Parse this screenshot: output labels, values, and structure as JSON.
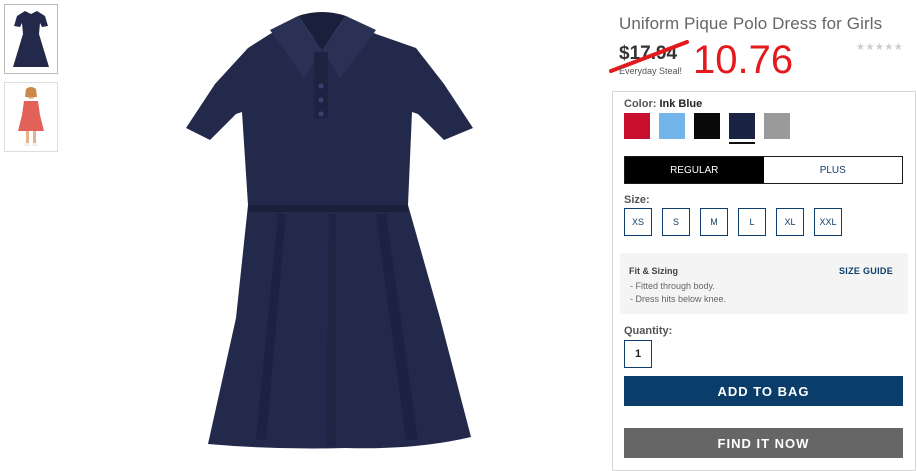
{
  "product": {
    "title": "Uniform Pique Polo Dress for Girls",
    "rating_stars": "★★★★★",
    "old_price": "$17.94",
    "price_note": "Everyday Steal!",
    "sale_price": "10.76"
  },
  "color": {
    "label": "Color:",
    "selected": "Ink Blue",
    "swatches": [
      {
        "name": "red",
        "hex": "#c8102e"
      },
      {
        "name": "light-blue",
        "hex": "#73b4ea"
      },
      {
        "name": "black",
        "hex": "#0a0a0a"
      },
      {
        "name": "ink-blue",
        "hex": "#1b2344"
      },
      {
        "name": "heather-gray",
        "hex": "#9a9a9a"
      }
    ]
  },
  "fit": {
    "options": [
      "REGULAR",
      "PLUS"
    ],
    "selected": "REGULAR"
  },
  "size": {
    "label": "Size:",
    "options": [
      "XS",
      "S",
      "M",
      "L",
      "XL",
      "XXL"
    ]
  },
  "fit_sizing": {
    "title": "Fit & Sizing",
    "guide_link": "SIZE GUIDE",
    "notes": [
      "Fitted through body.",
      "Dress hits below knee."
    ]
  },
  "quantity": {
    "label": "Quantity:",
    "value": "1"
  },
  "actions": {
    "add_to_bag": "ADD TO BAG",
    "find_it_now": "FIND IT NOW"
  },
  "colors": {
    "accent_navy": "#0b3d6b",
    "sale_red": "#e3191c",
    "dress_navy": "#23294a"
  }
}
